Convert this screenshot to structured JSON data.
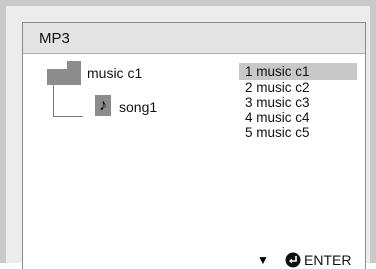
{
  "window": {
    "title": "MP3"
  },
  "tree": {
    "folder": {
      "label": "music c1",
      "icon": "folder-icon"
    },
    "file": {
      "label": "song1",
      "icon": "music-note-icon"
    }
  },
  "list": {
    "selected_index": 0,
    "items": [
      {
        "label": "1  music c1"
      },
      {
        "label": "2  music c2"
      },
      {
        "label": "3  music c3"
      },
      {
        "label": "4  music c4"
      },
      {
        "label": "5  music c5"
      }
    ]
  },
  "footer": {
    "down_icon": "down-arrow-icon",
    "enter_icon": "enter-icon",
    "enter_label": "ENTER"
  },
  "colors": {
    "selection": "#c8c8c8",
    "titlebar": "#e3e3e3",
    "icon_gray": "#8c8c8c"
  }
}
